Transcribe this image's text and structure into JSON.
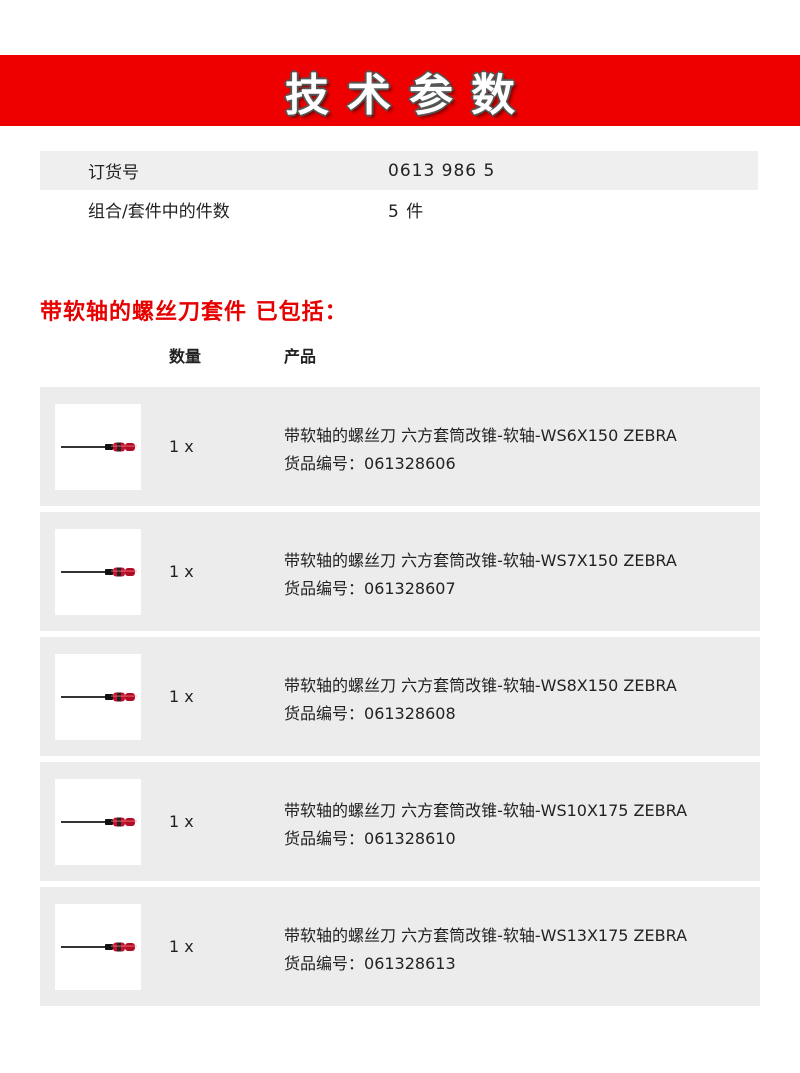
{
  "banner": {
    "title": "技术参数"
  },
  "specs": [
    {
      "label": "订货号",
      "value": "0613 986 5"
    },
    {
      "label": "组合/套件中的件数",
      "value": "5 件"
    }
  ],
  "section": {
    "title": "带软轴的螺丝刀套件 已包括：",
    "qty_header": "数量",
    "product_header": "产品"
  },
  "items": [
    {
      "qty": "1 x",
      "name": "带软轴的螺丝刀 六方套筒改锥-软轴-WS6X150 ZEBRA",
      "code_label": "货品编号：",
      "code": "061328606",
      "image_icon": "screwdriver-icon"
    },
    {
      "qty": "1 x",
      "name": "带软轴的螺丝刀 六方套筒改锥-软轴-WS7X150 ZEBRA",
      "code_label": "货品编号：",
      "code": "061328607",
      "image_icon": "screwdriver-icon"
    },
    {
      "qty": "1 x",
      "name": "带软轴的螺丝刀 六方套筒改锥-软轴-WS8X150 ZEBRA",
      "code_label": "货品编号：",
      "code": "061328608",
      "image_icon": "screwdriver-icon"
    },
    {
      "qty": "1 x",
      "name": "带软轴的螺丝刀 六方套筒改锥-软轴-WS10X175 ZEBRA",
      "code_label": "货品编号：",
      "code": "061328610",
      "image_icon": "screwdriver-icon"
    },
    {
      "qty": "1 x",
      "name": "带软轴的螺丝刀 六方套筒改锥-软轴-WS13X175 ZEBRA",
      "code_label": "货品编号：",
      "code": "061328613",
      "image_icon": "screwdriver-icon"
    }
  ],
  "colors": {
    "banner": "#ee0000",
    "section_title": "#e60000",
    "row_bg": "#ececec"
  }
}
